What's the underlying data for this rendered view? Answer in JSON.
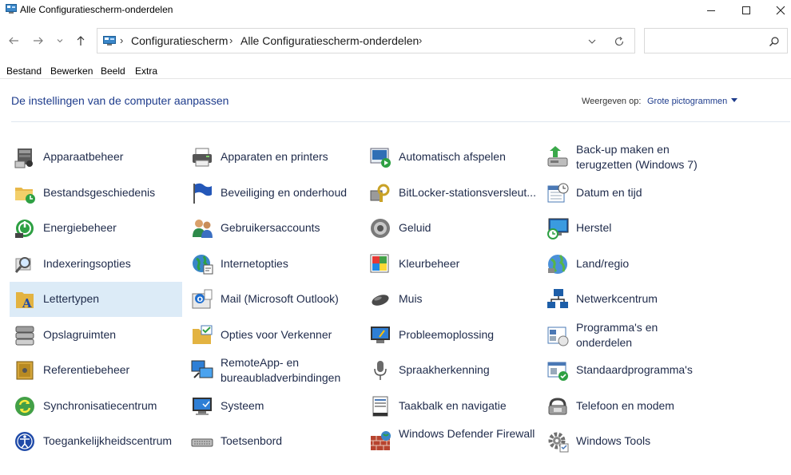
{
  "window": {
    "title": "Alle Configuratiescherm-onderdelen"
  },
  "address": {
    "crumbs": [
      "Configuratiescherm",
      "Alle Configuratiescherm-onderdelen"
    ],
    "search_placeholder": ""
  },
  "menu": [
    "Bestand",
    "Bewerken",
    "Beeld",
    "Extra"
  ],
  "header": {
    "title": "De instellingen van de computer aanpassen",
    "view_label": "Weergeven op:",
    "view_value": "Grote pictogrammen"
  },
  "colors": {
    "link": "#1e3c8c",
    "selected": "#dcebf7"
  },
  "items": [
    [
      "Apparaatbeheer",
      "Apparaten en printers",
      "Automatisch afspelen",
      "Back-up maken en terugzetten (Windows 7)"
    ],
    [
      "Bestandsgeschiedenis",
      "Beveiliging en onderhoud",
      "BitLocker-stationsversleut...",
      "Datum en tijd"
    ],
    [
      "Energiebeheer",
      "Gebruikersaccounts",
      "Geluid",
      "Herstel"
    ],
    [
      "Indexeringsopties",
      "Internetopties",
      "Kleurbeheer",
      "Land/regio"
    ],
    [
      "Lettertypen",
      "Mail (Microsoft Outlook)",
      "Muis",
      "Netwerkcentrum"
    ],
    [
      "Opslagruimten",
      "Opties voor Verkenner",
      "Probleemoplossing",
      "Programma's en onderdelen"
    ],
    [
      "Referentiebeheer",
      "RemoteApp- en bureaubladverbindingen",
      "Spraakherkenning",
      "Standaardprogramma's"
    ],
    [
      "Synchronisatiecentrum",
      "Systeem",
      "Taakbalk en navigatie",
      "Telefoon en modem"
    ],
    [
      "Toegankelijkheidscentrum",
      "Toetsenbord",
      "Windows Defender Firewall",
      "Windows Tools"
    ]
  ],
  "icons": [
    [
      "device-manager-icon",
      "printer-icon",
      "autoplay-icon",
      "backup-icon"
    ],
    [
      "file-history-icon",
      "flag-icon",
      "bitlocker-key-icon",
      "calendar-clock-icon"
    ],
    [
      "power-icon",
      "users-icon",
      "speaker-icon",
      "recovery-icon"
    ],
    [
      "indexing-icon",
      "globe-icon",
      "color-management-icon",
      "region-globe-icon"
    ],
    [
      "font-folder-icon",
      "mail-icon",
      "mouse-icon",
      "network-icon"
    ],
    [
      "storage-icon",
      "folder-options-icon",
      "troubleshoot-icon",
      "programs-icon"
    ],
    [
      "credential-safe-icon",
      "remote-desktop-icon",
      "microphone-icon",
      "default-programs-icon"
    ],
    [
      "sync-icon",
      "system-monitor-icon",
      "taskbar-icon",
      "phone-modem-icon"
    ],
    [
      "accessibility-icon",
      "keyboard-icon",
      "firewall-icon",
      "gear-icon"
    ]
  ]
}
